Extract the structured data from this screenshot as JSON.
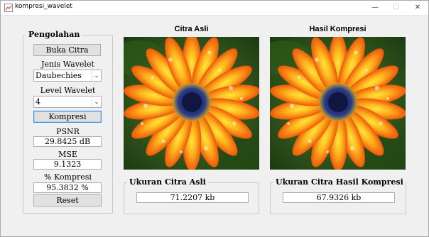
{
  "window": {
    "title": "kompresi_wavelet"
  },
  "panel": {
    "title": "Pengolahan",
    "open_button": "Buka Citra",
    "wavelet_type_label": "Jenis Wavelet",
    "wavelet_type_value": "Daubechies",
    "wavelet_level_label": "Level Wavelet",
    "wavelet_level_value": "4",
    "compress_button": "Kompresi",
    "psnr_label": "PSNR",
    "psnr_value": "29.8425 dB",
    "mse_label": "MSE",
    "mse_value": "9.1323",
    "compression_label": "% Kompresi",
    "compression_value": "95.3832 %",
    "reset_button": "Reset"
  },
  "images": {
    "original_title": "Citra Asli",
    "compressed_title": "Hasil Kompresi"
  },
  "sizes": {
    "original_title": "Ukuran Citra Asli",
    "original_value": "71.2207 kb",
    "compressed_title": "Ukuran Citra Hasil Kompresi",
    "compressed_value": "67.9326 kb"
  },
  "colors": {
    "petal_orange": "#f07a10",
    "petal_yellow": "#ffd21a",
    "center_blue": "#1f2a6b",
    "leaf_green": "#3a6e1e",
    "focus_blue": "#3c8fd8"
  },
  "icons": {
    "app": "matlab-figure-icon",
    "minimize": "minimize-icon",
    "maximize": "maximize-icon",
    "close": "close-icon",
    "dropdown": "chevron-down-icon"
  }
}
